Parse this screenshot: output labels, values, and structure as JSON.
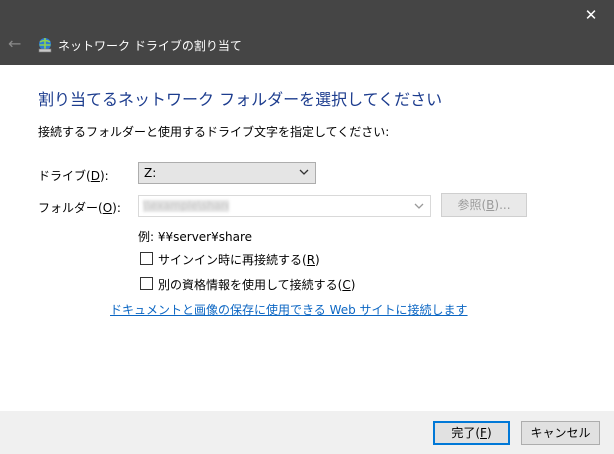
{
  "window": {
    "close_glyph": "✕",
    "back_glyph": "←",
    "title": "ネットワーク ドライブの割り当て"
  },
  "main": {
    "heading": "割り当てるネットワーク フォルダーを選択してください",
    "instruction": "接続するフォルダーと使用するドライブ文字を指定してください:",
    "drive_label_prefix": "ドライブ(",
    "drive_label_key": "D",
    "drive_label_suffix": "):",
    "drive_value": "Z:",
    "folder_label_prefix": "フォルダー(",
    "folder_label_key": "O",
    "folder_label_suffix": "):",
    "folder_value": "\\\\example\\share",
    "browse_prefix": "参照(",
    "browse_key": "B",
    "browse_suffix": ")...",
    "example_text": "例: ¥¥server¥share",
    "reconnect_prefix": "サインイン時に再接続する(",
    "reconnect_key": "R",
    "reconnect_suffix": ")",
    "reconnect_checked": false,
    "credentials_prefix": "別の資格情報を使用して接続する(",
    "credentials_key": "C",
    "credentials_suffix": ")",
    "credentials_checked": false,
    "link_text": "ドキュメントと画像の保存に使用できる Web サイトに接続します"
  },
  "footer": {
    "finish_prefix": "完了(",
    "finish_key": "F",
    "finish_suffix": ")",
    "cancel_label": "キャンセル"
  },
  "colors": {
    "titlebar": "#454545",
    "heading": "#1c3c8e",
    "link": "#0b66c3",
    "footer": "#f0f0f0",
    "focus_border": "#0078d7"
  },
  "icons": {
    "close": "close-icon",
    "back": "back-arrow-icon",
    "wizard": "network-drive-icon",
    "dropdown": "chevron-down-icon"
  }
}
